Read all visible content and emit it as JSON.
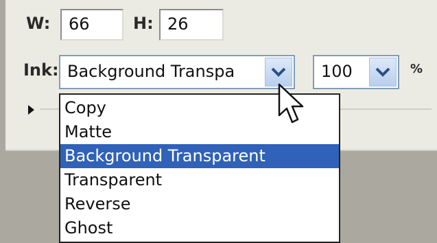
{
  "dimensions": {
    "width_label": "W:",
    "width_value": "66",
    "height_label": "H:",
    "height_value": "26"
  },
  "ink": {
    "label": "Ink:",
    "selected": "Background Transpa",
    "options": [
      "Copy",
      "Matte",
      "Background Transparent",
      "Transparent",
      "Reverse",
      "Ghost"
    ],
    "highlighted_index": 2
  },
  "blend": {
    "value": "100",
    "unit": "%"
  },
  "colors": {
    "highlight": "#2f62b8",
    "panel": "#ecebe3"
  },
  "icons": {
    "dropdown_arrow": "chevron-down-icon",
    "expand": "expand-triangle-icon",
    "cursor": "mouse-pointer-icon"
  }
}
